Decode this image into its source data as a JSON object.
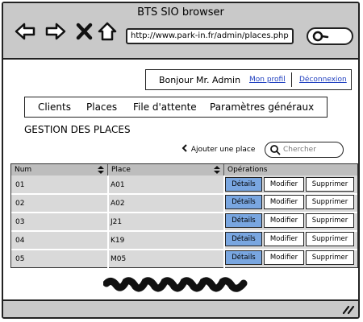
{
  "window": {
    "title": "BTS SIO browser"
  },
  "browser": {
    "url": "http://www.park-in.fr/admin/places.php",
    "icons": [
      "back-arrow-icon",
      "forward-arrow-icon",
      "close-x-icon",
      "home-icon",
      "search-icon"
    ]
  },
  "user_bar": {
    "greeting": "Bonjour Mr. Admin",
    "profile_link": "Mon profil",
    "logout_link": "Déconnexion"
  },
  "menu": {
    "items": [
      "Clients",
      "Places",
      "File d'attente",
      "Paramètres généraux"
    ]
  },
  "page": {
    "title": "GESTION DES PLACES",
    "add_label": "Ajouter une place",
    "search_placeholder": "Chercher"
  },
  "table": {
    "headers": {
      "num": "Num",
      "place": "Place",
      "ops": "Opérations"
    },
    "rows": [
      {
        "num": "01",
        "place": "A01"
      },
      {
        "num": "02",
        "place": "A02"
      },
      {
        "num": "03",
        "place": "J21"
      },
      {
        "num": "04",
        "place": "K19"
      },
      {
        "num": "05",
        "place": "M05"
      }
    ],
    "actions": {
      "details": "Détails",
      "edit": "Modifier",
      "delete": "Supprimer"
    }
  },
  "colors": {
    "frame_gray": "#c9c9c9",
    "accent_blue": "#79a6e0",
    "link_blue": "#1f3fbf"
  }
}
